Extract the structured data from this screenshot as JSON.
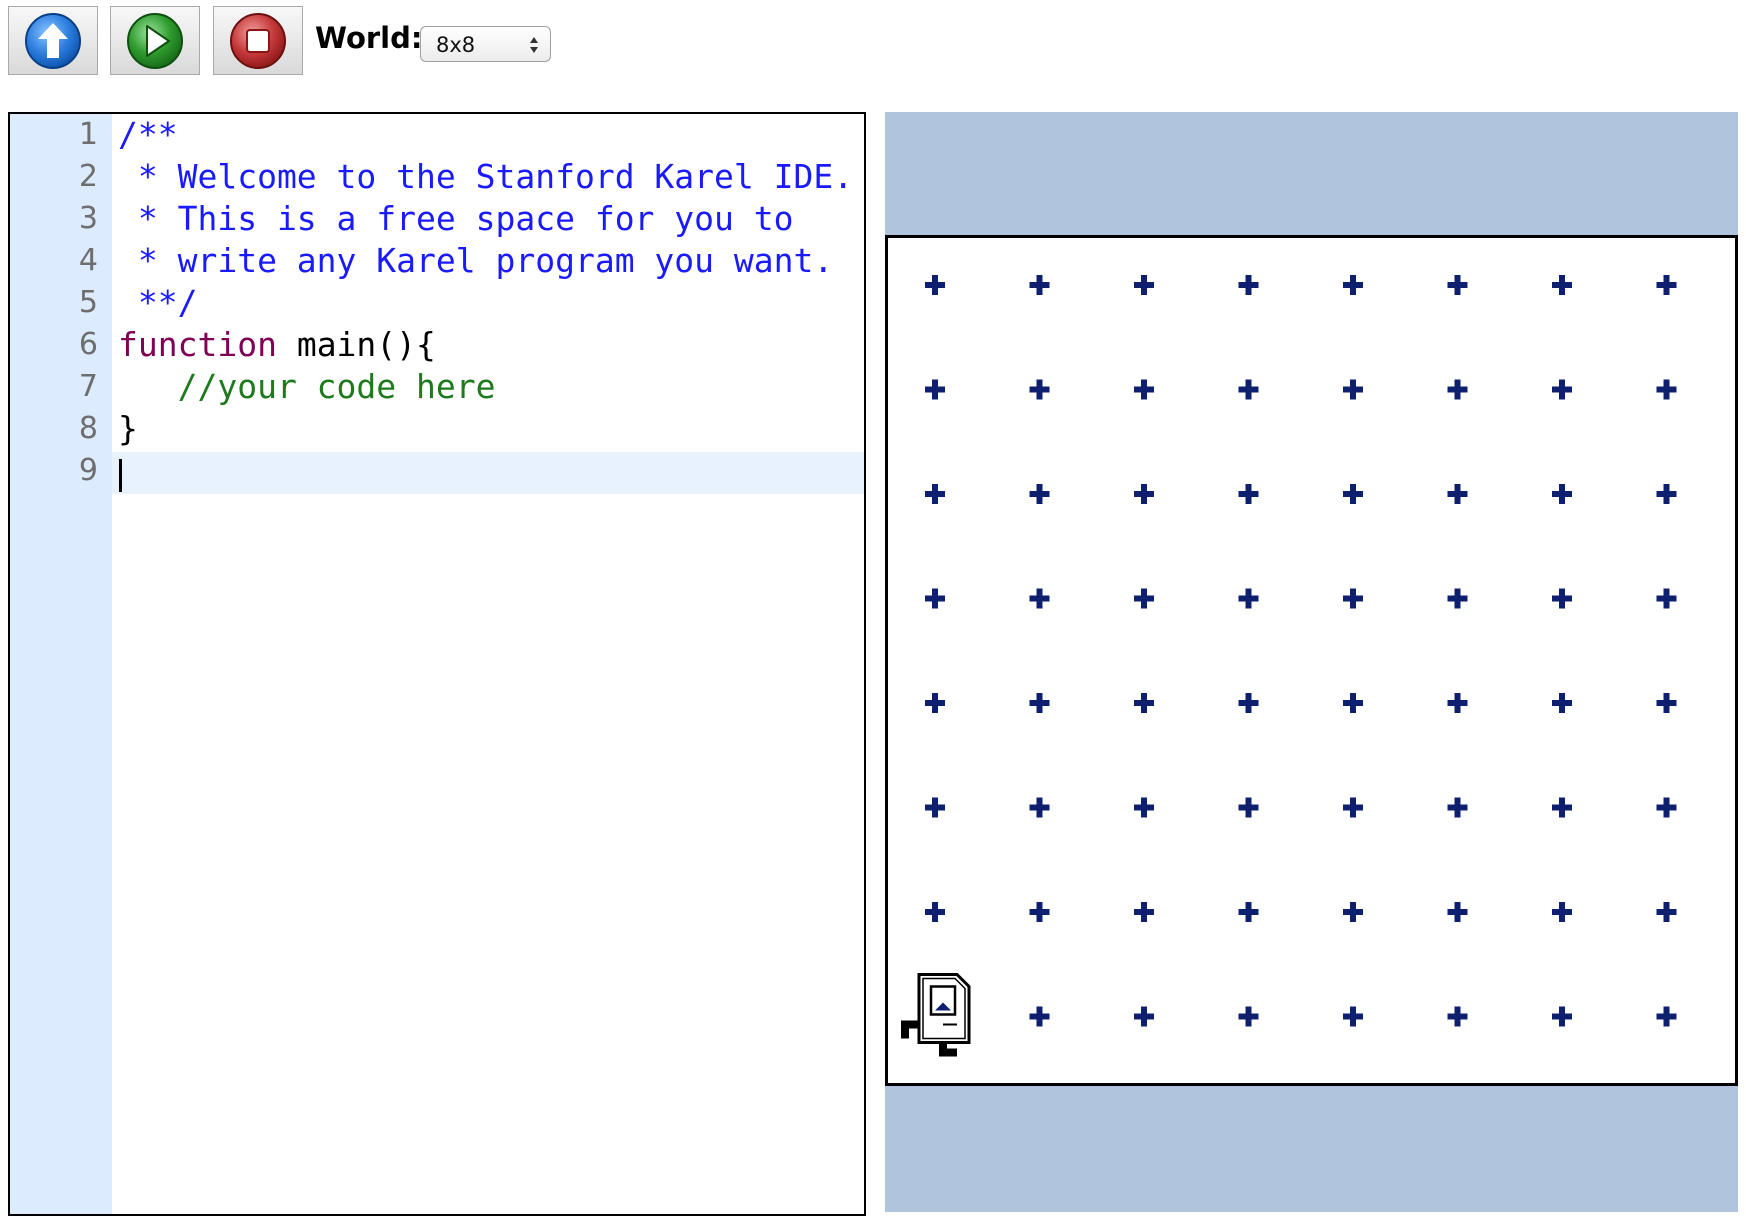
{
  "toolbar": {
    "buttons": [
      {
        "name": "upload-button",
        "icon": "arrow-up-icon",
        "color": "#2d7fe0"
      },
      {
        "name": "run-button",
        "icon": "play-icon",
        "color": "#2e9b2e"
      },
      {
        "name": "stop-button",
        "icon": "stop-icon",
        "color": "#c63a3a"
      }
    ],
    "world_label": "World:",
    "world_select": {
      "value": "8x8",
      "arrow_icon": "updown-arrows-icon"
    }
  },
  "editor": {
    "line_numbers": [
      "1",
      "2",
      "3",
      "4",
      "5",
      "6",
      "7",
      "8",
      "9"
    ],
    "lines": [
      {
        "tokens": [
          {
            "type": "comment",
            "text": "/**"
          }
        ]
      },
      {
        "tokens": [
          {
            "type": "comment",
            "text": " * Welcome to the Stanford Karel IDE."
          }
        ]
      },
      {
        "tokens": [
          {
            "type": "comment",
            "text": " * This is a free space for you to"
          }
        ]
      },
      {
        "tokens": [
          {
            "type": "comment",
            "text": " * write any Karel program you want."
          }
        ]
      },
      {
        "tokens": [
          {
            "type": "comment",
            "text": " **/"
          }
        ]
      },
      {
        "tokens": [
          {
            "type": "keyword",
            "text": "function"
          },
          {
            "type": "plain",
            "text": " main(){"
          }
        ]
      },
      {
        "tokens": [
          {
            "type": "green",
            "text": "   //your code here"
          }
        ]
      },
      {
        "tokens": [
          {
            "type": "plain",
            "text": "}"
          }
        ]
      },
      {
        "tokens": []
      }
    ],
    "active_line": 9,
    "colors": {
      "gutter": "#dcebfd",
      "active_line": "#e8f2fe",
      "comment": "#1a1aff",
      "keyword": "#7f0055",
      "green_comment": "#1d7a1d"
    }
  },
  "world": {
    "rows": 8,
    "cols": 8,
    "corner_marker_icon": "plus-icon",
    "corner_color": "#0d1f6e",
    "background": "#b0c4de",
    "karel": {
      "icon": "karel-robot-icon",
      "row": 1,
      "col": 1,
      "facing": "east"
    }
  }
}
